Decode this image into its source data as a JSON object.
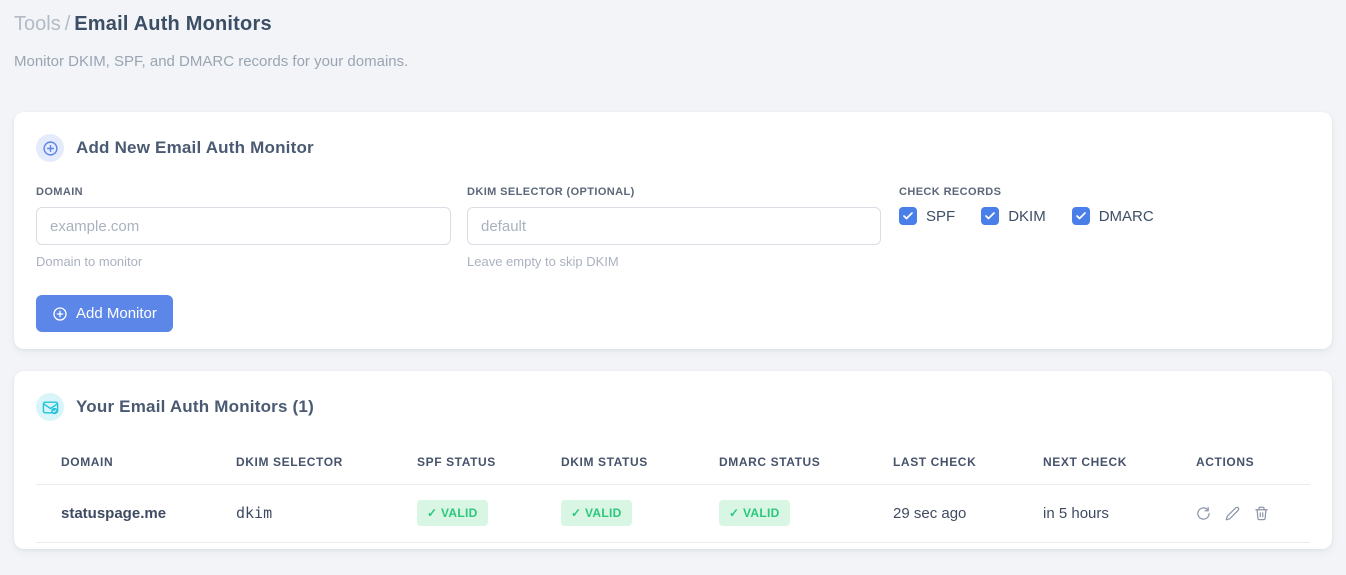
{
  "page": {
    "breadcrumb": {
      "section": "Tools",
      "separator": "/",
      "title": "Email Auth Monitors"
    },
    "subtitle": "Monitor DKIM, SPF, and DMARC records for your domains."
  },
  "add_form": {
    "title": "Add New Email Auth Monitor",
    "domain_field": {
      "label": "DOMAIN",
      "placeholder": "example.com",
      "value": "",
      "hint": "Domain to monitor"
    },
    "dkim_selector_field": {
      "label": "DKIM SELECTOR (OPTIONAL)",
      "placeholder": "default",
      "value": "",
      "hint": "Leave empty to skip DKIM"
    },
    "check_records": {
      "label": "CHECK RECORDS",
      "options": [
        {
          "label": "SPF",
          "checked": true
        },
        {
          "label": "DKIM",
          "checked": true
        },
        {
          "label": "DMARC",
          "checked": true
        }
      ]
    },
    "submit_label": "Add Monitor"
  },
  "monitors": {
    "title": "Your Email Auth Monitors (1)",
    "count": "1",
    "table": {
      "headers": [
        "DOMAIN",
        "DKIM SELECTOR",
        "SPF STATUS",
        "DKIM STATUS",
        "DMARC STATUS",
        "LAST CHECK",
        "NEXT CHECK",
        "ACTIONS"
      ],
      "rows": [
        {
          "domain": "statuspage.me",
          "dkim_selector": "dkim",
          "spf_status": "✓ VALID",
          "dkim_status": "✓ VALID",
          "dmarc_status": "✓ VALID",
          "last_check": "29 sec ago",
          "next_check": "in 5 hours"
        }
      ]
    },
    "actions": {
      "refresh": "refresh",
      "edit": "edit",
      "delete": "delete"
    }
  },
  "colors": {
    "accent_blue": "#5c86e8",
    "checkbox_blue": "#4a7ee8",
    "valid_bg": "#d9f6e5",
    "valid_text": "#2bc77d",
    "selector_pink": "#e8447e",
    "cyan_icon": "#22c3d9",
    "page_bg": "#f2f4f7"
  }
}
